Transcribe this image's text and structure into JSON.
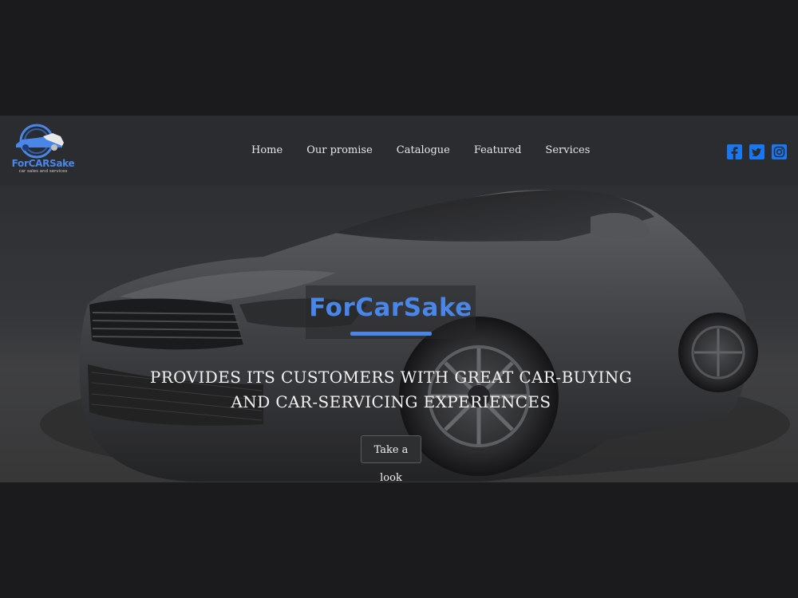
{
  "logo": {
    "name": "ForCARSake",
    "tagline": "car sales and services"
  },
  "nav": {
    "items": [
      {
        "label": "Home"
      },
      {
        "label": "Our promise"
      },
      {
        "label": "Catalogue"
      },
      {
        "label": "Featured"
      },
      {
        "label": "Services"
      }
    ]
  },
  "social": {
    "icons": [
      "facebook-icon",
      "twitter-icon",
      "instagram-icon"
    ],
    "color": "#1877f2"
  },
  "hero": {
    "brand": "ForCarSake",
    "tagline_line1": "PROVIDES ITS CUSTOMERS WITH GREAT CAR-BUYING",
    "tagline_line2": "AND CAR-SERVICING EXPERIENCES",
    "cta_label": "Take a look"
  },
  "colors": {
    "accent": "#4a86e8",
    "page_bg": "#1b1b1d",
    "header_bg": "#2b2c2f"
  }
}
